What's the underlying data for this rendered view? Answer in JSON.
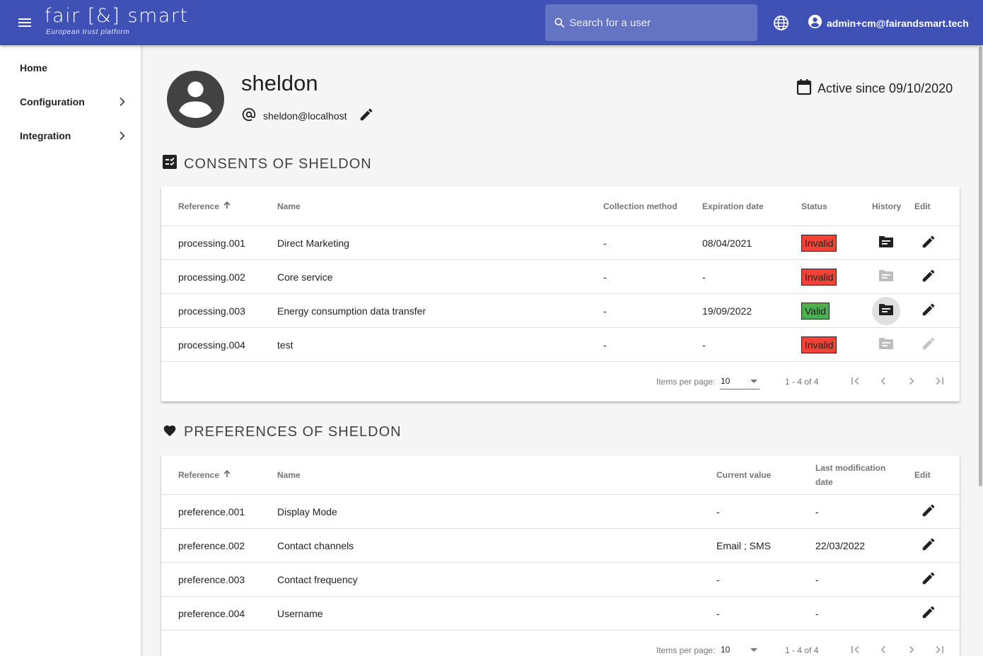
{
  "topbar": {
    "logo_main": "fair [&] smart",
    "logo_sub": "European trust platform",
    "search_placeholder": "Search for a user",
    "account_label": "admin+cm@fairandsmart.tech",
    "color": "#3f51b5"
  },
  "sidebar": {
    "items": [
      {
        "label": "Home",
        "has_children": false
      },
      {
        "label": "Configuration",
        "has_children": true
      },
      {
        "label": "Integration",
        "has_children": true
      }
    ]
  },
  "profile": {
    "username": "sheldon",
    "email": "sheldon@localhost",
    "active_since": "Active since 09/10/2020"
  },
  "consents": {
    "title": "CONSENTS OF SHELDON",
    "headers": {
      "reference": "Reference",
      "name": "Name",
      "collection_method": "Collection method",
      "expiration_date": "Expiration date",
      "status": "Status",
      "history": "History",
      "edit": "Edit"
    },
    "rows": [
      {
        "reference": "processing.001",
        "name": "Direct Marketing",
        "collection_method": "-",
        "expiration_date": "08/04/2021",
        "status": "Invalid",
        "history_enabled": true,
        "edit_enabled": true
      },
      {
        "reference": "processing.002",
        "name": "Core service",
        "collection_method": "-",
        "expiration_date": "-",
        "status": "Invalid",
        "history_enabled": false,
        "edit_enabled": true
      },
      {
        "reference": "processing.003",
        "name": "Energy consumption data transfer",
        "collection_method": "-",
        "expiration_date": "19/09/2022",
        "status": "Valid",
        "history_enabled": true,
        "edit_enabled": true
      },
      {
        "reference": "processing.004",
        "name": "test",
        "collection_method": "-",
        "expiration_date": "-",
        "status": "Invalid",
        "history_enabled": false,
        "edit_enabled": false
      }
    ],
    "paginator": {
      "items_per_page_label": "Items per page:",
      "page_size": "10",
      "range": "1 - 4 of 4"
    }
  },
  "preferences": {
    "title": "PREFERENCES OF SHELDON",
    "headers": {
      "reference": "Reference",
      "name": "Name",
      "current_value": "Current value",
      "last_modification_date": "Last modification date",
      "edit": "Edit"
    },
    "rows": [
      {
        "reference": "preference.001",
        "name": "Display Mode",
        "current_value": "-",
        "last_modification_date": "-"
      },
      {
        "reference": "preference.002",
        "name": "Contact channels",
        "current_value": "Email ; SMS",
        "last_modification_date": "22/03/2022"
      },
      {
        "reference": "preference.003",
        "name": "Contact frequency",
        "current_value": "-",
        "last_modification_date": "-"
      },
      {
        "reference": "preference.004",
        "name": "Username",
        "current_value": "-",
        "last_modification_date": "-"
      }
    ],
    "paginator": {
      "items_per_page_label": "Items per page:",
      "page_size": "10",
      "range": "1 - 4 of 4"
    }
  },
  "colors": {
    "invalid": "#f44336",
    "valid": "#4caf50",
    "primary": "#3f51b5"
  }
}
